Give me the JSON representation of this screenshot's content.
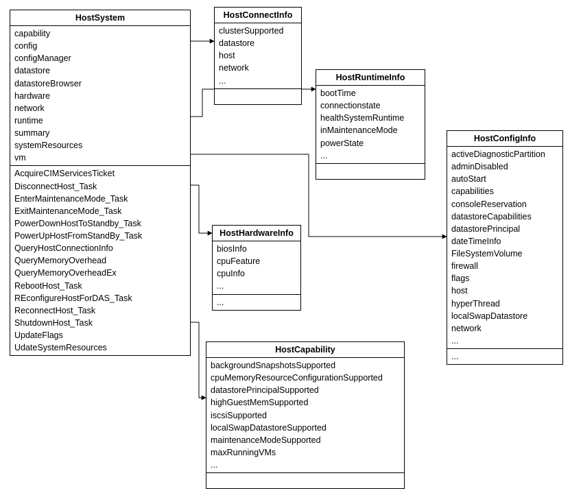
{
  "classes": {
    "hostSystem": {
      "title": "HostSystem",
      "attrs": [
        "capability",
        "config",
        "configManager",
        "datastore",
        "datastoreBrowser",
        "hardware",
        "network",
        "runtime",
        "summary",
        "systemResources",
        "vm"
      ],
      "ops": [
        "AcquireCIMServicesTicket",
        "DisconnectHost_Task",
        "EnterMaintenanceMode_Task",
        "ExitMaintenanceMode_Task",
        "PowerDownHostToStandby_Task",
        "PowerUpHostFromStandBy_Task",
        "QueryHostConnectionInfo",
        "QueryMemoryOverhead",
        "QueryMemoryOverheadEx",
        "RebootHost_Task",
        "REconfigureHostForDAS_Task",
        "ReconnectHost_Task",
        "ShutdownHost_Task",
        "UpdateFlags",
        "UdateSystemResources"
      ]
    },
    "hostConnectInfo": {
      "title": "HostConnectInfo",
      "attrs": [
        "clusterSupported",
        "datastore",
        "host",
        "network",
        "..."
      ],
      "ops": [
        ""
      ]
    },
    "hostRuntimeInfo": {
      "title": "HostRuntimeInfo",
      "attrs": [
        "bootTime",
        "connectionstate",
        "healthSystemRuntime",
        "inMaintenanceMode",
        "powerState",
        "..."
      ],
      "ops": [
        ""
      ]
    },
    "hostConfigInfo": {
      "title": "HostConfigInfo",
      "attrs": [
        "activeDiagnosticPartition",
        "adminDisabled",
        "autoStart",
        "capabilities",
        "consoleReservation",
        "datastoreCapabilities",
        "datastorePrincipal",
        "dateTimeInfo",
        "FileSystemVolume",
        "firewall",
        "flags",
        "host",
        "hyperThread",
        "localSwapDatastore",
        "network",
        "..."
      ],
      "ops": [
        "..."
      ]
    },
    "hostHardwareInfo": {
      "title": "HostHardwareInfo",
      "attrs": [
        "biosInfo",
        "cpuFeature",
        "cpuInfo",
        "..."
      ],
      "ops": [
        "..."
      ]
    },
    "hostCapability": {
      "title": "HostCapability",
      "attrs": [
        "backgroundSnapshotsSupported",
        "cpuMemoryResourceConfigurationSupported",
        "datastorePrincipalSupported",
        "highGuestMemSupported",
        "iscsiSupported",
        "localSwapDatastoreSupported",
        "maintenanceModeSupported",
        "maxRunningVMs",
        "..."
      ],
      "ops": [
        ""
      ]
    }
  }
}
